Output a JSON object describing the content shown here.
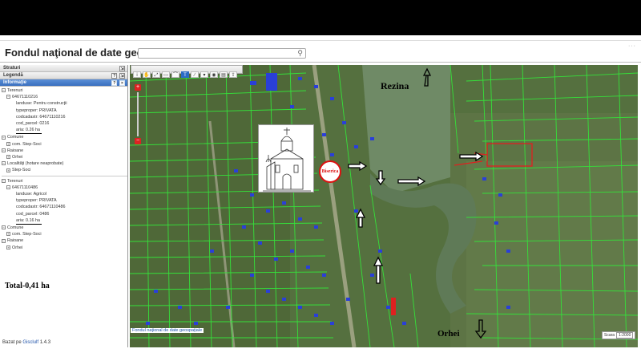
{
  "app": {
    "title": "Fondul naţional de date geospaţiale"
  },
  "search": {
    "placeholder": ""
  },
  "sidebar": {
    "straturi": "Straturi",
    "legenda": "Legendă",
    "informatie": "Informaţie",
    "btn_help": "?",
    "btn_close": "×",
    "group1": {
      "terenuri": "Terenuri",
      "id": "64671110216",
      "landuse": "landuse: Pentru construcţii",
      "typeproper": "typeproper: PRIVATA",
      "codcadastr": "codcadastr: 64671110216",
      "cod_parcel": "cod_parcel: 0216",
      "aria": "aria: 0.26 ha",
      "comune": "Comune",
      "comune_item": "com. Step-Soci",
      "raioane": "Raioane",
      "raioane_item": "Orhei",
      "localitati": "Localităţi (hotare neaprobate)",
      "localitati_item": "Step-Soci"
    },
    "group2": {
      "terenuri": "Terenuri",
      "id": "64671110486",
      "landuse": "landuse: Agricol",
      "typeproper": "typeproper: PRIVATA",
      "codcadastr": "codcadastr: 64671110486",
      "cod_parcel": "cod_parcel: 0486",
      "aria": "aria: 0.16 ha",
      "comune": "Comune",
      "comune_item": "com. Step-Soci",
      "raioane": "Raioane",
      "raioane_item": "Orhei"
    },
    "total": "Total-0,41 ha",
    "footer_prefix": "Bazat pe",
    "footer_link": "Gisclulf",
    "footer_version": "1.4.3"
  },
  "map": {
    "labels": {
      "rezina": "Rezina",
      "orhei": "Orhei",
      "biserica": "Biserica"
    },
    "credit": "Fondul naţional de date geospaţiale",
    "scale_label": "Scara",
    "scale_value": "1:2000",
    "colors": {
      "parcel": "#35e03a",
      "highlight": "#e02020",
      "building": "#2a3fd8",
      "water": "#6f8a66"
    }
  },
  "toolbar": {
    "icons": [
      "info-icon",
      "pan-icon",
      "zoom-extent-icon",
      "zoom-box-icon",
      "measure-icon",
      "text-tool-icon",
      "draw-line-icon",
      "dropdown-icon",
      "locate-icon",
      "stop-icon",
      "print-icon",
      "export-icon"
    ],
    "text_tool": "T"
  }
}
